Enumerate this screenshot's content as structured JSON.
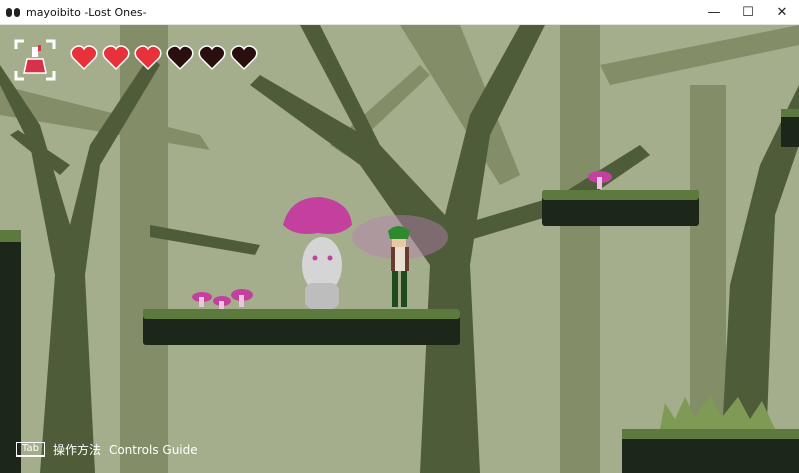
{
  "window": {
    "title": "mayoibito -Lost Ones-"
  },
  "window_controls": {
    "minimize": "—",
    "maximize": "☐",
    "close": "✕"
  },
  "hud": {
    "hearts_total": 6,
    "hearts_full": 3,
    "heart_full_color": "#e8313a",
    "heart_empty_color": "#2a0f10",
    "potion_color": "#d8314a"
  },
  "controls_guide": {
    "key": "Tab",
    "label_cn": "操作方法",
    "label_en": "Controls Guide"
  },
  "colors": {
    "sky": "#a5ae8c",
    "trees_far": "#7f8a63",
    "trees_near": "#4d5a38",
    "platform_grass": "#5d7a3e",
    "platform_dirt": "#1c2619",
    "mushroom": "#c4409f"
  }
}
